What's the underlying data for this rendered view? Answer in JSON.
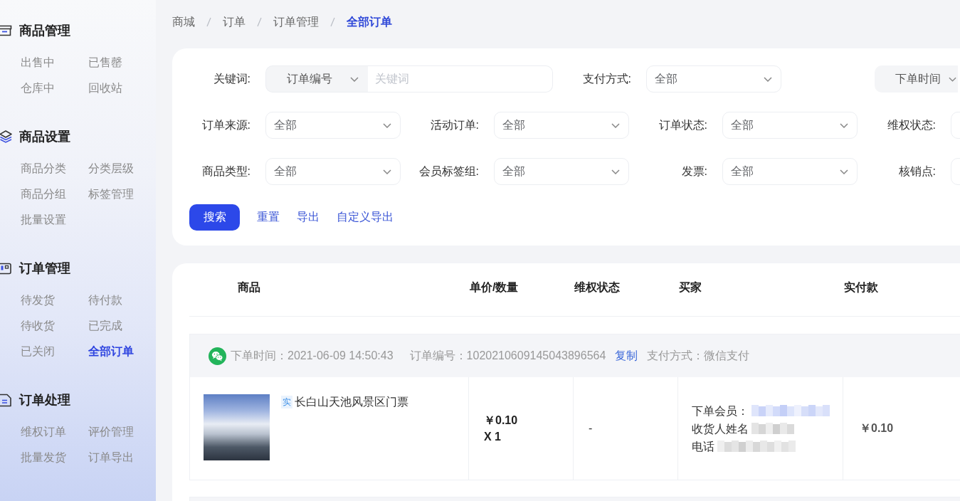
{
  "sidebar": {
    "sections": [
      {
        "title": "商品管理",
        "items": [
          {
            "label": "出售中",
            "selected": false
          },
          {
            "label": "已售罄",
            "selected": false
          },
          {
            "label": "仓库中",
            "selected": false
          },
          {
            "label": "回收站",
            "selected": false
          }
        ]
      },
      {
        "title": "商品设置",
        "items": [
          {
            "label": "商品分类",
            "selected": false
          },
          {
            "label": "分类层级",
            "selected": false
          },
          {
            "label": "商品分组",
            "selected": false
          },
          {
            "label": "标签管理",
            "selected": false
          },
          {
            "label": "批量设置",
            "selected": false
          }
        ]
      },
      {
        "title": "订单管理",
        "items": [
          {
            "label": "待发货",
            "selected": false
          },
          {
            "label": "待付款",
            "selected": false
          },
          {
            "label": "待收货",
            "selected": false
          },
          {
            "label": "已完成",
            "selected": false
          },
          {
            "label": "已关闭",
            "selected": false
          },
          {
            "label": "全部订单",
            "selected": true
          }
        ]
      },
      {
        "title": "订单处理",
        "items": [
          {
            "label": "维权订单",
            "selected": false
          },
          {
            "label": "评价管理",
            "selected": false
          },
          {
            "label": "批量发货",
            "selected": false
          },
          {
            "label": "订单导出",
            "selected": false
          }
        ]
      }
    ]
  },
  "breadcrumb": {
    "items": [
      {
        "label": "商城",
        "current": false
      },
      {
        "label": "订单",
        "current": false
      },
      {
        "label": "订单管理",
        "current": false
      },
      {
        "label": "全部订单",
        "current": true
      }
    ]
  },
  "filters": {
    "rows": [
      [
        {
          "kind": "keyword",
          "label": "关键词:",
          "select": "订单编号",
          "placeholder": "关键词"
        },
        {
          "kind": "select",
          "label": "支付方式:",
          "value": "全部"
        },
        "",
        {
          "kind": "plain-select",
          "value": "下单时间"
        }
      ],
      [
        {
          "kind": "select",
          "label": "订单来源:",
          "value": "全部"
        },
        {
          "kind": "select",
          "label": "活动订单:",
          "value": "全部"
        },
        {
          "kind": "select",
          "label": "订单状态:",
          "value": "全部"
        },
        {
          "kind": "select",
          "label": "维权状态:"
        }
      ],
      [
        {
          "kind": "select",
          "label": "商品类型:",
          "value": "全部"
        },
        {
          "kind": "select",
          "label": "会员标签组:",
          "value": "全部"
        },
        {
          "kind": "select",
          "label": "发票:",
          "value": "全部"
        },
        {
          "kind": "input",
          "label": "核销点:"
        }
      ]
    ],
    "actions": [
      {
        "kind": "primary",
        "label": "搜索"
      },
      {
        "kind": "link",
        "label": "重置"
      },
      {
        "kind": "link",
        "label": "导出"
      },
      {
        "kind": "link",
        "label": "自定义导出"
      }
    ]
  },
  "orders_table": {
    "columns": [
      "商品",
      "单价/数量",
      "维权状态",
      "买家",
      "实付款"
    ],
    "orders": [
      {
        "placed": "下单时间：2021-06-09 14:50:43",
        "order_number": "订单编号：1020210609145043896564",
        "copy": "复制",
        "payment": "支付方式：微信支付",
        "items": [
          {
            "tag": "实",
            "name": "长白山天池风景区门票",
            "price": "￥0.10",
            "quantity": "X 1"
          }
        ],
        "rights_status": "-",
        "buyer": [
          "下单会员：",
          "收货人姓名",
          "电话"
        ],
        "paid": "￥0.10"
      }
    ]
  }
}
